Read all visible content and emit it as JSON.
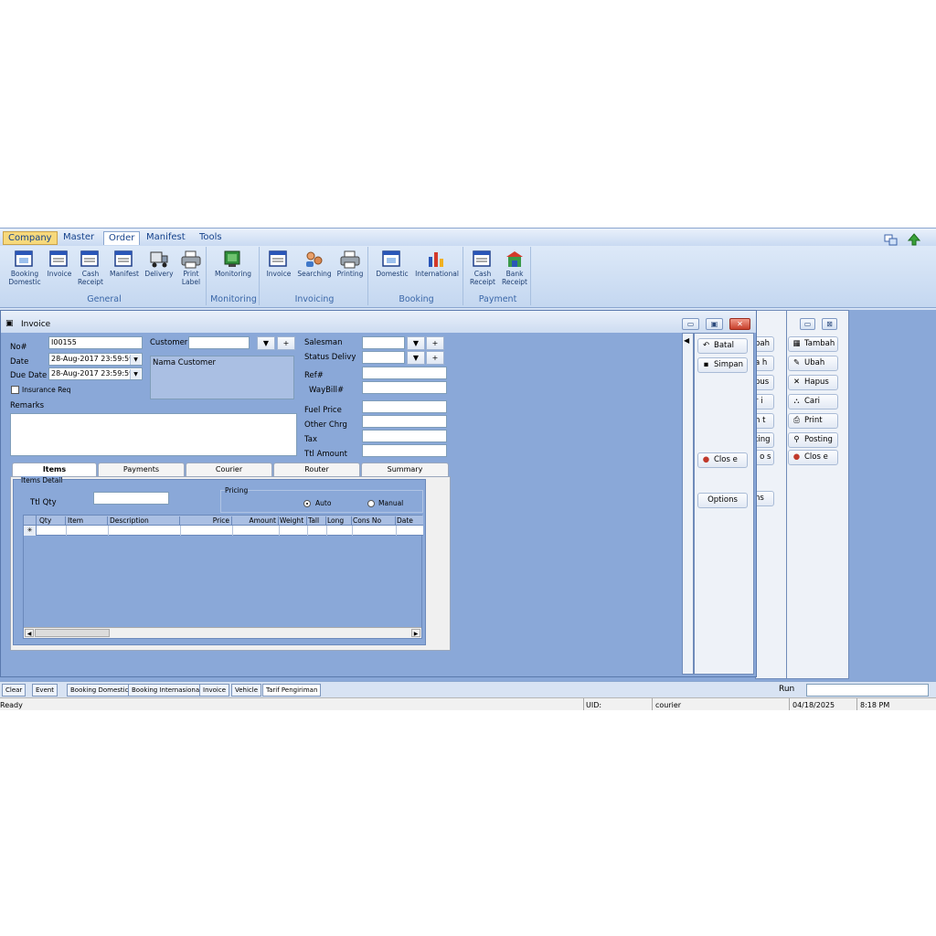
{
  "menu": [
    "Company",
    "Master",
    "Order",
    "Manifest",
    "Tools"
  ],
  "ribbon": {
    "groups": [
      {
        "label": "General",
        "buttons": [
          {
            "label": "Booking Domestic",
            "icon": "window-icon"
          },
          {
            "label": "Invoice",
            "icon": "window-icon"
          },
          {
            "label": "Cash Receipt",
            "icon": "window-icon"
          },
          {
            "label": "Manifest",
            "icon": "window-icon"
          },
          {
            "label": "Delivery",
            "icon": "truck-icon"
          },
          {
            "label": "Print Label",
            "icon": "printer-icon"
          }
        ]
      },
      {
        "label": "Monitoring",
        "buttons": [
          {
            "label": "Monitoring",
            "icon": "monitor-icon"
          }
        ]
      },
      {
        "label": "Invoicing",
        "buttons": [
          {
            "label": "Invoice",
            "icon": "window-icon"
          },
          {
            "label": "Searching",
            "icon": "search-people-icon"
          },
          {
            "label": "Printing",
            "icon": "printer-icon"
          }
        ]
      },
      {
        "label": "Booking",
        "buttons": [
          {
            "label": "Domestic",
            "icon": "window-icon"
          },
          {
            "label": "International",
            "icon": "chart-icon"
          }
        ]
      },
      {
        "label": "Payment",
        "buttons": [
          {
            "label": "Cash Receipt",
            "icon": "window-icon"
          },
          {
            "label": "Bank Receipt",
            "icon": "building-icon"
          }
        ]
      }
    ]
  },
  "invoice": {
    "title": "Invoice",
    "no_label": "No#",
    "no_value": "I00155",
    "date_label": "Date",
    "date_value": "28-Aug-2017 23:59:59",
    "due_label": "Due Date",
    "due_value": "28-Aug-2017 23:59:59",
    "insurance_label": "Insurance Req",
    "remarks_label": "Remarks",
    "customer_label": "Customer",
    "customer_name": "Nama Customer",
    "salesman_label": "Salesman",
    "status_label": "Status Delivy",
    "ref_label": "Ref#",
    "waybill_label": "WayBill#",
    "fuel_label": "Fuel Price",
    "other_label": "Other Chrg",
    "tax_label": "Tax",
    "ttl_amount_label": "Ttl Amount",
    "tabs": [
      "Items",
      "Payments",
      "Courier",
      "Router",
      "Summary"
    ],
    "items_detail_label": "Items Detail",
    "ttl_qty_label": "Ttl Qty",
    "pricing_label": "Pricing",
    "auto_label": "Auto",
    "manual_label": "Manual",
    "columns": [
      "Qty",
      "Item",
      "Description",
      "Price",
      "Amount",
      "Weight",
      "Tall",
      "Long",
      "Cons No",
      "Date"
    ],
    "new_row_marker": "✳"
  },
  "panel1": {
    "batal": "Batal",
    "simpan": "Simpan",
    "close": "Clos e",
    "options": "Options"
  },
  "panel2": {
    "items": [
      "bah",
      "a h",
      "pus",
      "r i",
      "n t",
      "ting",
      "l o s",
      "ns"
    ]
  },
  "panel3": {
    "tambah": "Tambah",
    "ubah": "Ubah",
    "hapus": "Hapus",
    "cari": "Cari",
    "print": "Print",
    "posting": "Posting",
    "close": "Clos e"
  },
  "taskbar": {
    "clear": "Clear",
    "event": "Event",
    "tasks": [
      "Booking Domestic",
      "Booking Internasional",
      "Invoice",
      "Vehicle",
      "Tarif Pengiriman"
    ],
    "run_label": "Run"
  },
  "status": {
    "ready": "Ready",
    "uid": "UID:",
    "user": "courier",
    "date": "04/18/2025",
    "time": "8:18 PM"
  }
}
